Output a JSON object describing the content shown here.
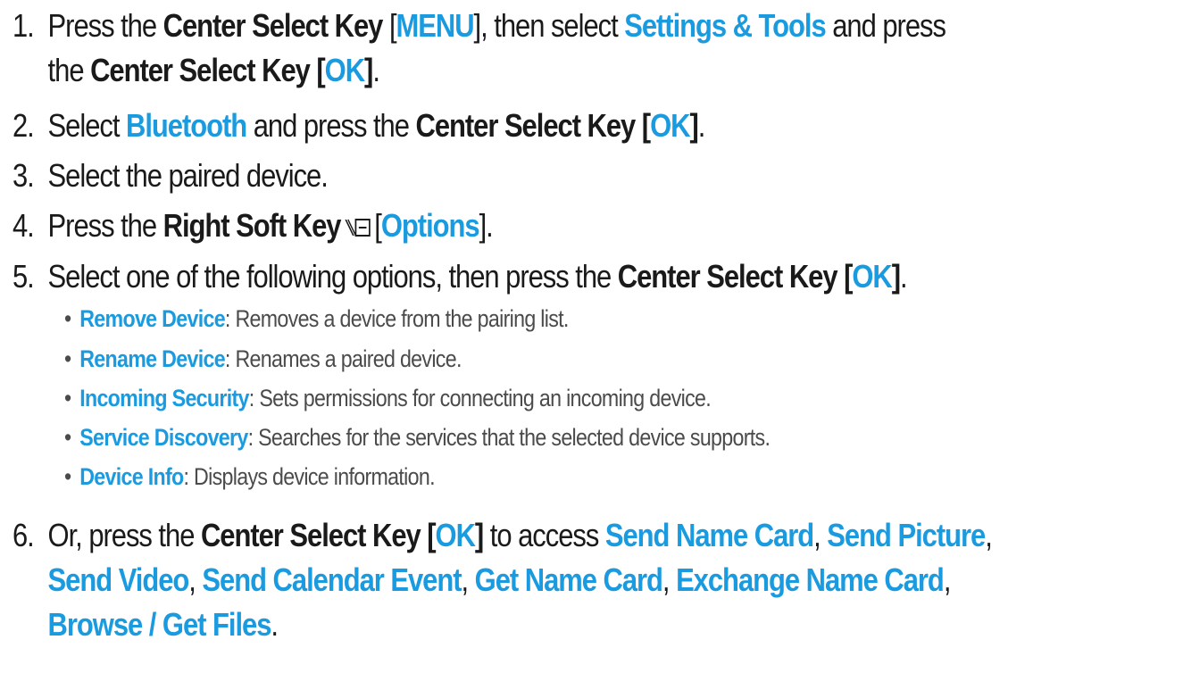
{
  "steps": {
    "s1": {
      "num": "1.",
      "t1": "Press the ",
      "k1": "Center Select Key",
      "t2": " [",
      "v1": "MENU",
      "t3": "], then select ",
      "v2": "Settings & Tools",
      "t4": " and press",
      "t5": "the ",
      "k2": "Center Select Key [",
      "v3": "OK",
      "t6": "]",
      "t7": "."
    },
    "s2": {
      "num": "2.",
      "t1": "Select ",
      "v1": "Bluetooth",
      "t2": " and press the ",
      "k1": "Center Select Key [",
      "v2": "OK",
      "k2": "]",
      "t3": "."
    },
    "s3": {
      "num": "3.",
      "t1": "Select the paired device."
    },
    "s4": {
      "num": "4.",
      "t1": "Press the ",
      "k1": "Right Soft Key",
      "icon": "right-soft-key-icon",
      "t2": "[",
      "v1": "Options",
      "t3": "]."
    },
    "s5": {
      "num": "5.",
      "t1": "Select one of the following options, then press the ",
      "k1": "Center Select Key [",
      "v1": "OK",
      "k2": "]",
      "t2": ".",
      "bullets": [
        {
          "term": "Remove Device",
          "desc": ": Removes a device from the pairing list."
        },
        {
          "term": "Rename Device",
          "desc": ": Renames a paired device."
        },
        {
          "term": "Incoming Security",
          "desc": ": Sets permissions for connecting an incoming device."
        },
        {
          "term": "Service Discovery",
          "desc": ": Searches for the services that the selected device supports."
        },
        {
          "term": "Device Info",
          "desc": ": Displays device information."
        }
      ]
    },
    "s6": {
      "num": "6.",
      "t1": "Or, press the ",
      "k1": "Center Select Key [",
      "v1": "OK",
      "k2": "]",
      "t2": " to access ",
      "v2": "Send Name Card",
      "c1": ", ",
      "v3": "Send Picture",
      "c2": ",",
      "v4": "Send Video",
      "c3": ", ",
      "v5": "Send Calendar Event",
      "c4": ", ",
      "v6": "Get Name Card",
      "c5": ", ",
      "v7": "Exchange Name Card",
      "c6": ",",
      "v8": "Browse / Get Files",
      "c7": "."
    }
  },
  "colors": {
    "accent": "#1a9be0",
    "text": "#1a1a1a",
    "bullet_text": "#4b4b4b"
  }
}
